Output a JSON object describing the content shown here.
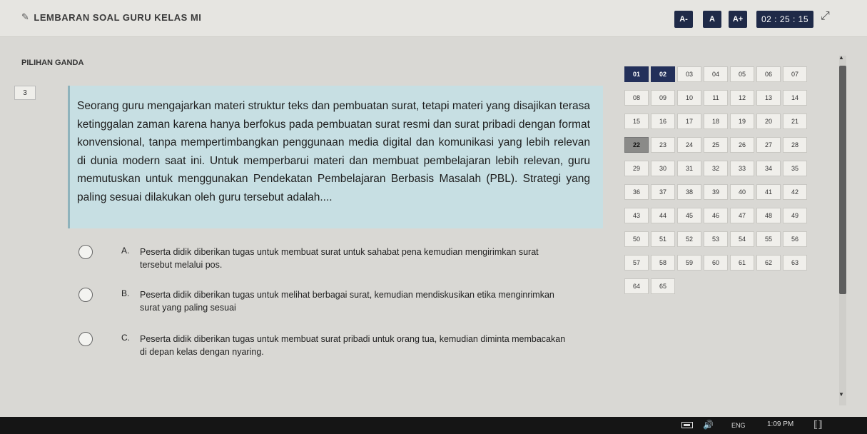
{
  "header": {
    "title": "LEMBARAN SOAL GURU KELAS MI",
    "font_buttons": [
      "A-",
      "A",
      "A+"
    ],
    "timer": "02 : 25 : 15"
  },
  "section": {
    "label": "PILIHAN GANDA"
  },
  "question": {
    "number": "3",
    "text": "Seorang guru mengajarkan materi struktur teks dan pembuatan surat, tetapi materi yang disajikan terasa ketinggalan zaman karena hanya berfokus pada pembuatan surat resmi dan surat pribadi dengan format konvensional, tanpa mempertimbangkan penggunaan media digital dan komunikasi yang lebih relevan di dunia modern saat ini. Untuk memperbarui materi dan membuat pembelajaran lebih relevan, guru memutuskan untuk menggunakan Pendekatan Pembelajaran Berbasis Masalah (PBL). Strategi yang paling sesuai dilakukan oleh guru tersebut adalah...."
  },
  "options": [
    {
      "letter": "A.",
      "text": "Peserta didik diberikan tugas untuk membuat surat untuk sahabat pena kemudian mengirimkan surat tersebut melalui pos."
    },
    {
      "letter": "B.",
      "text": "Peserta didik diberikan tugas untuk melihat berbagai surat, kemudian mendiskusikan etika menginrimkan surat yang paling sesuai"
    },
    {
      "letter": "C.",
      "text": "Peserta didik diberikan tugas untuk membuat surat pribadi untuk orang tua, kemudian diminta membacakan di depan kelas dengan nyaring."
    }
  ],
  "grid": {
    "cells": [
      "01",
      "02",
      "03",
      "04",
      "05",
      "06",
      "07",
      "08",
      "09",
      "10",
      "11",
      "12",
      "13",
      "14",
      "15",
      "16",
      "17",
      "18",
      "19",
      "20",
      "21",
      "22",
      "23",
      "24",
      "25",
      "26",
      "27",
      "28",
      "29",
      "30",
      "31",
      "32",
      "33",
      "34",
      "35",
      "36",
      "37",
      "38",
      "39",
      "40",
      "41",
      "42",
      "43",
      "44",
      "45",
      "46",
      "47",
      "48",
      "49",
      "50",
      "51",
      "52",
      "53",
      "54",
      "55",
      "56",
      "57",
      "58",
      "59",
      "60",
      "61",
      "62",
      "63",
      "64",
      "65"
    ],
    "answered": [
      "01",
      "02"
    ],
    "current": "22"
  },
  "taskbar": {
    "lang": "ENG",
    "time": "1:09 PM"
  },
  "colors": {
    "accent": "#1f2a48",
    "question_bg": "#c7dfe3"
  }
}
